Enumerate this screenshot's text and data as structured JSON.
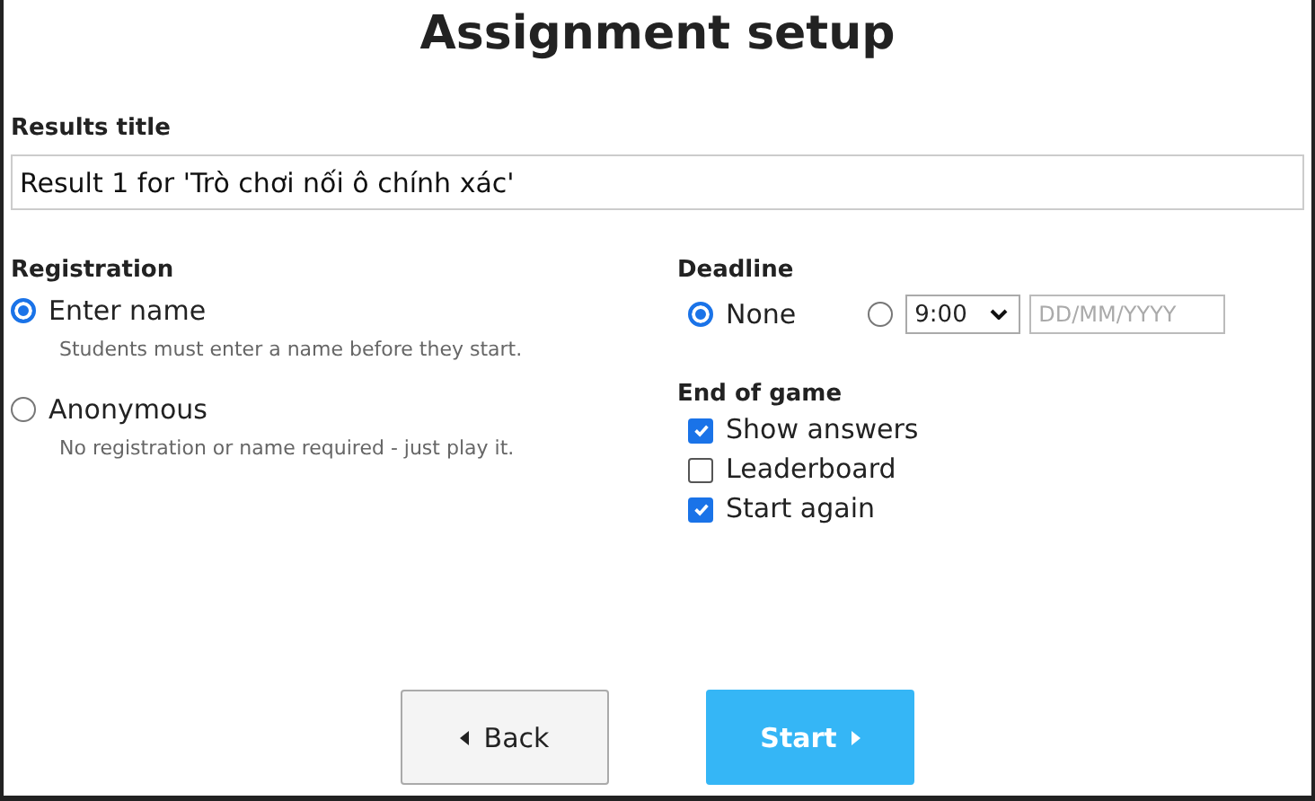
{
  "title": "Assignment setup",
  "results_title": {
    "label": "Results title",
    "value": "Result 1 for 'Trò chơi nối ô chính xác'"
  },
  "registration": {
    "label": "Registration",
    "options": [
      {
        "label": "Enter name",
        "hint": "Students must enter a name before they start.",
        "selected": true
      },
      {
        "label": "Anonymous",
        "hint": "No registration or name required - just play it.",
        "selected": false
      }
    ]
  },
  "deadline": {
    "label": "Deadline",
    "options": [
      {
        "kind": "none",
        "label": "None",
        "selected": true
      },
      {
        "kind": "date",
        "time": "9:00",
        "date_placeholder": "DD/MM/YYYY",
        "selected": false
      }
    ]
  },
  "end_of_game": {
    "label": "End of game",
    "options": [
      {
        "label": "Show answers",
        "checked": true
      },
      {
        "label": "Leaderboard",
        "checked": false
      },
      {
        "label": "Start again",
        "checked": true
      }
    ]
  },
  "buttons": [
    {
      "kind": "back",
      "label": "Back"
    },
    {
      "kind": "start",
      "label": "Start"
    }
  ]
}
